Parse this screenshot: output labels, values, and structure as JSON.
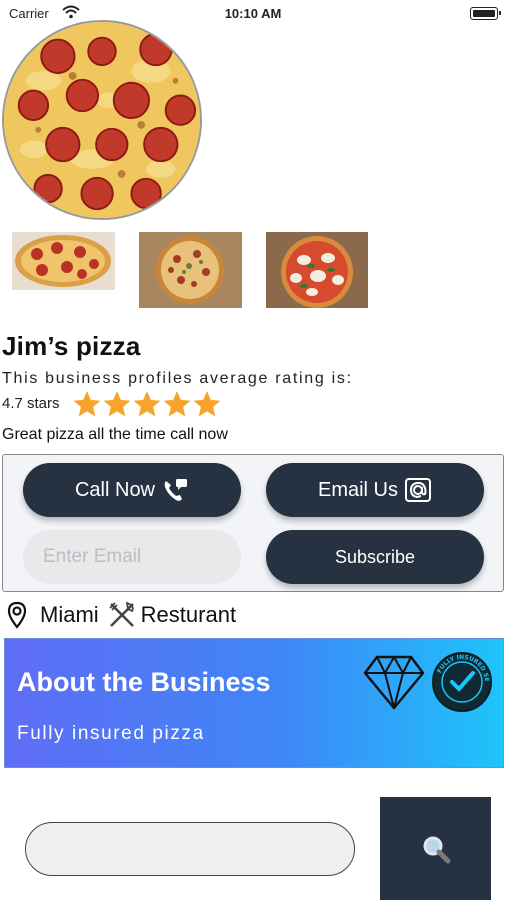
{
  "status_bar": {
    "carrier": "Carrier",
    "time": "10:10 AM"
  },
  "business": {
    "name": "Jim’s pizza",
    "rating_caption": "This business profiles average rating is:",
    "rating_text": "4.7 stars",
    "star_count": 5,
    "tagline": "Great pizza all the time call now"
  },
  "actions": {
    "call_label": "Call Now",
    "email_label": "Email Us",
    "email_placeholder": "Enter Email",
    "subscribe_label": "Subscribe"
  },
  "location": {
    "city": "Miami",
    "category": "Resturant"
  },
  "about": {
    "title": "About the Business",
    "subtitle": "Fully insured pizza",
    "badge_text": "FULLY INSURED SERVICE"
  },
  "search": {
    "value": ""
  },
  "colors": {
    "button_dark": "#263141",
    "star": "#f7a32c",
    "about_gradient_start": "#5f6df5",
    "about_gradient_end": "#1ec4fb"
  },
  "icons": {
    "wifi": "wifi-icon",
    "battery": "battery-icon",
    "star": "star-icon",
    "phone": "phone-icon",
    "email": "at-sign-icon",
    "pin": "map-pin-icon",
    "utensils": "utensils-icon",
    "diamond": "diamond-icon",
    "badge": "insured-badge-icon",
    "search": "search-icon"
  }
}
